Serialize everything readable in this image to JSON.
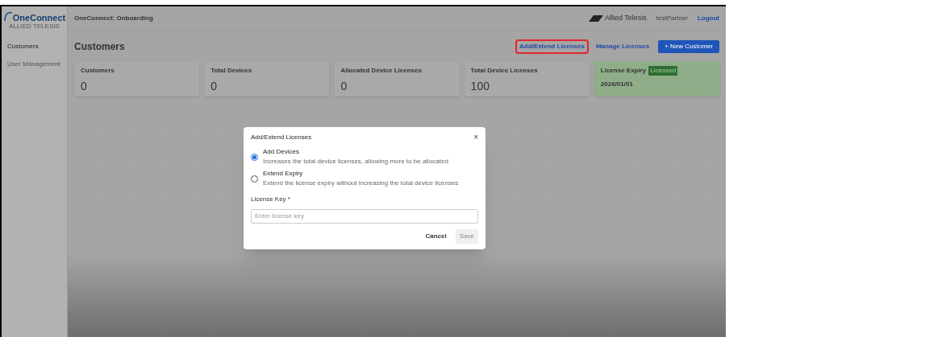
{
  "logo": {
    "name": "OneConnect",
    "tagline": "ALLIED TELESIS"
  },
  "header": {
    "title": "OneConnect: Onboarding",
    "brand": "Allied Telesis",
    "user": "testPartner",
    "logout": "Logout"
  },
  "sidebar": {
    "items": [
      {
        "label": "Customers",
        "selected": true
      },
      {
        "label": "User Management",
        "selected": false
      }
    ]
  },
  "page": {
    "title": "Customers",
    "actions": [
      {
        "label": "Add/Extend Licenses",
        "kind": "link",
        "highlighted": true
      },
      {
        "label": "Manage Licenses",
        "kind": "link",
        "highlighted": false
      },
      {
        "label": "+ New Customer",
        "kind": "primary",
        "highlighted": false
      }
    ]
  },
  "stats": [
    {
      "label": "Customers",
      "value": "0",
      "kind": "plain"
    },
    {
      "label": "Total Devices",
      "value": "0",
      "kind": "plain"
    },
    {
      "label": "Allocated Device Licenses",
      "value": "0",
      "kind": "plain"
    },
    {
      "label": "Total Device Licenses",
      "value": "100",
      "kind": "plain"
    },
    {
      "label": "License Expiry",
      "value": "2026/01/01",
      "kind": "status",
      "badge": "Licensed"
    }
  ],
  "dialog": {
    "title": "Add/Extend Licenses",
    "close": "×",
    "options": [
      {
        "label": "Add Devices",
        "description": "Increases the total device licenses, allowing more to be allocated",
        "selected": true
      },
      {
        "label": "Extend Expiry",
        "description": "Extend the license expiry without increasing the total device licenses",
        "selected": false
      }
    ],
    "field": {
      "label": "License Key *",
      "placeholder": "Enter license key"
    },
    "buttons": [
      {
        "label": "Cancel",
        "disabled": false
      },
      {
        "label": "Save",
        "disabled": true
      }
    ]
  }
}
